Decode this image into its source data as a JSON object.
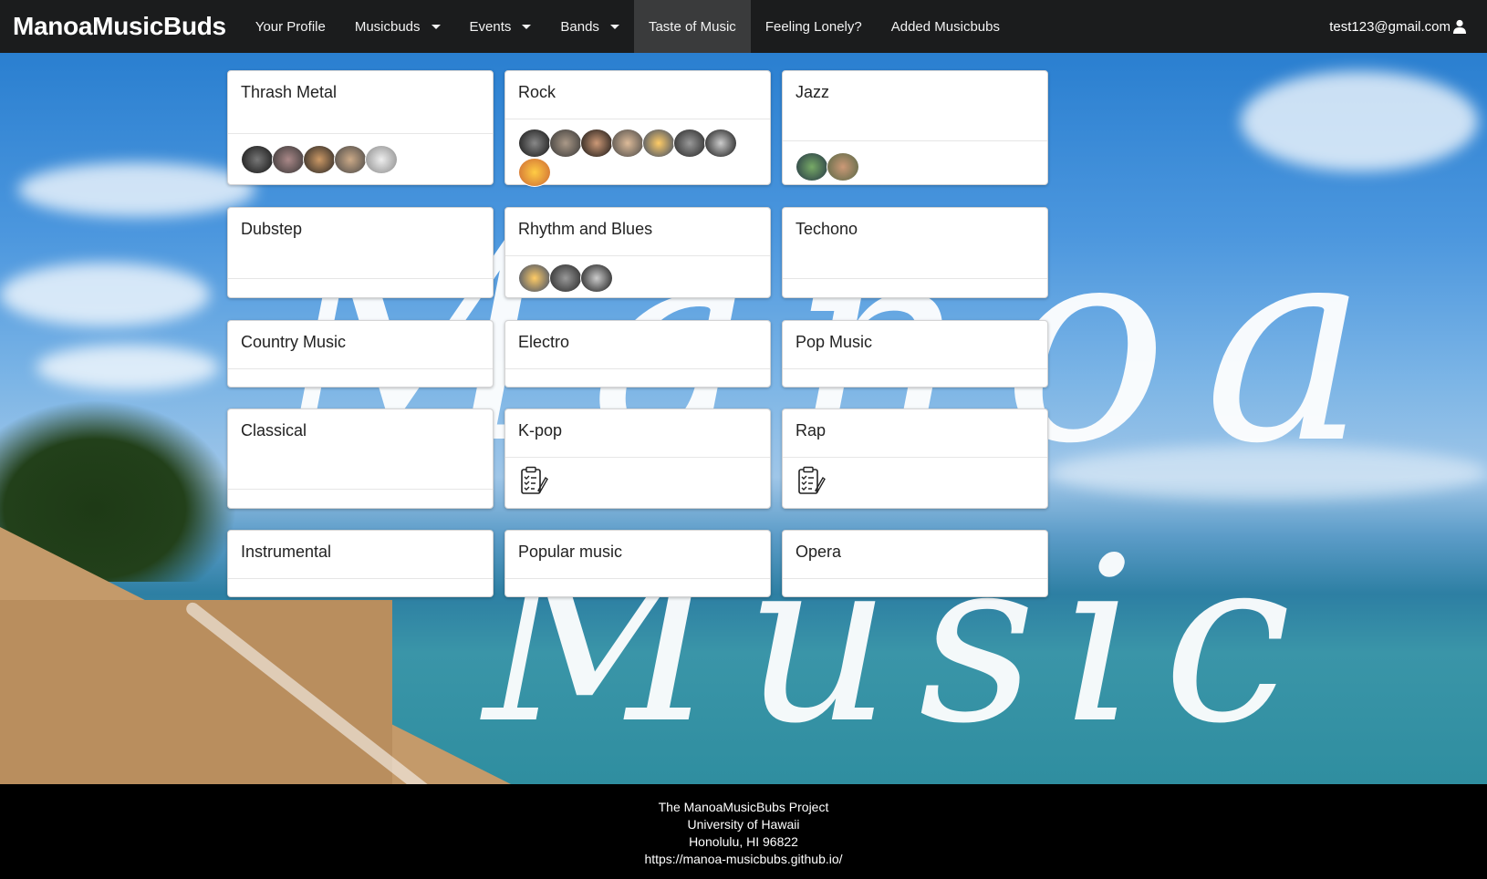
{
  "navbar": {
    "brand": "ManoaMusicBuds",
    "items": [
      {
        "label": "Your Profile"
      },
      {
        "label": "Musicbuds"
      },
      {
        "label": "Events"
      },
      {
        "label": "Bands"
      },
      {
        "label": "Taste of Music"
      },
      {
        "label": "Feeling Lonely?"
      },
      {
        "label": "Added Musicbubs"
      }
    ],
    "user_email": "test123@gmail.com"
  },
  "background": {
    "script_word_1": "Manoa",
    "script_word_2": "Music"
  },
  "genres": [
    {
      "title": "Thrash Metal"
    },
    {
      "title": "Rock"
    },
    {
      "title": "Jazz"
    },
    {
      "title": "Dubstep"
    },
    {
      "title": "Rhythm and Blues"
    },
    {
      "title": "Techono"
    },
    {
      "title": "Country Music"
    },
    {
      "title": "Electro"
    },
    {
      "title": "Pop Music"
    },
    {
      "title": "Classical"
    },
    {
      "title": "K-pop"
    },
    {
      "title": "Rap"
    },
    {
      "title": "Instrumental"
    },
    {
      "title": "Popular music"
    },
    {
      "title": "Opera"
    }
  ],
  "footer": {
    "line1": "The ManoaMusicBubs Project",
    "line2": "University of Hawaii",
    "line3": "Honolulu, HI 96822",
    "line4": "https://manoa-musicbubs.github.io/"
  }
}
